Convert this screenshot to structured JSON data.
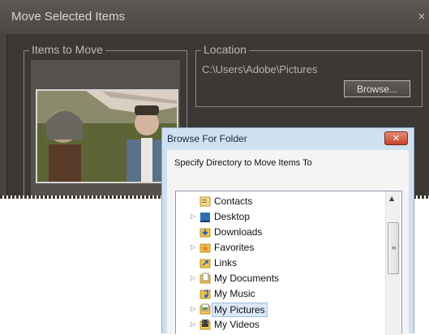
{
  "main_dialog": {
    "title": "Move Selected Items",
    "close_glyph": "×",
    "items_group_label": "Items to Move",
    "location_group_label": "Location",
    "location_path": "C:\\Users\\Adobe\\Pictures",
    "browse_label": "Browse..."
  },
  "browse_dialog": {
    "title": "Browse For Folder",
    "close_glyph": "✕",
    "instruction": "Specify Directory to Move Items To",
    "tree_items": [
      {
        "label": "Contacts",
        "icon": "contacts-folder-icon",
        "expandable": false,
        "selected": false
      },
      {
        "label": "Desktop",
        "icon": "desktop-folder-icon",
        "expandable": true,
        "selected": false
      },
      {
        "label": "Downloads",
        "icon": "downloads-folder-icon",
        "expandable": false,
        "selected": false
      },
      {
        "label": "Favorites",
        "icon": "favorites-folder-icon",
        "expandable": true,
        "selected": false
      },
      {
        "label": "Links",
        "icon": "links-folder-icon",
        "expandable": false,
        "selected": false
      },
      {
        "label": "My Documents",
        "icon": "documents-folder-icon",
        "expandable": true,
        "selected": false
      },
      {
        "label": "My Music",
        "icon": "music-folder-icon",
        "expandable": false,
        "selected": false
      },
      {
        "label": "My Pictures",
        "icon": "pictures-folder-icon",
        "expandable": true,
        "selected": true
      },
      {
        "label": "My Videos",
        "icon": "videos-folder-icon",
        "expandable": true,
        "selected": false
      }
    ]
  }
}
